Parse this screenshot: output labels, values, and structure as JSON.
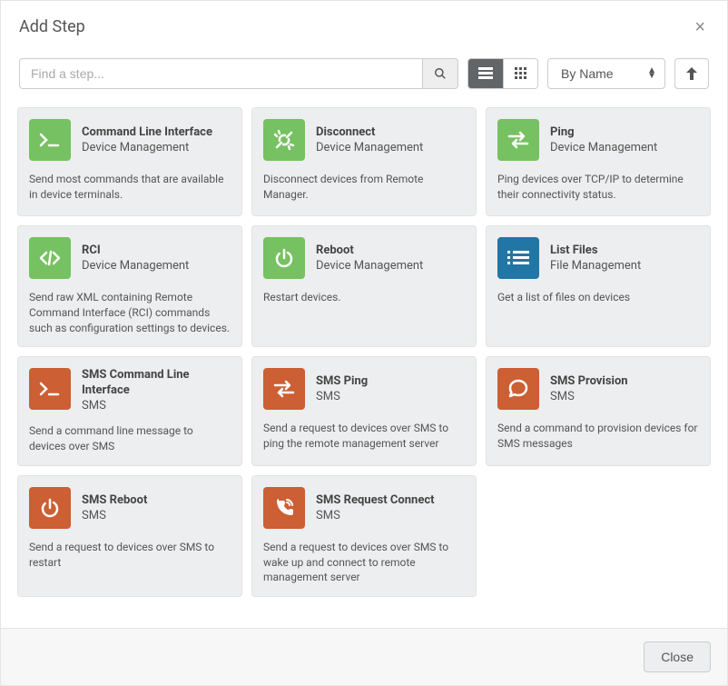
{
  "header": {
    "title": "Add Step"
  },
  "toolbar": {
    "search_placeholder": "Find a step...",
    "sort_selected": "By Name"
  },
  "cards": [
    {
      "title": "Command Line Interface",
      "category": "Device Management",
      "description": "Send most commands that are available in device terminals.",
      "icon": "terminal",
      "color": "green"
    },
    {
      "title": "Disconnect",
      "category": "Device Management",
      "description": "Disconnect devices from Remote Manager.",
      "icon": "disconnect",
      "color": "green"
    },
    {
      "title": "Ping",
      "category": "Device Management",
      "description": "Ping devices over TCP/IP to determine their connectivity status.",
      "icon": "exchange",
      "color": "green"
    },
    {
      "title": "RCI",
      "category": "Device Management",
      "description": "Send raw XML containing Remote Command Interface (RCI) commands such as configuration settings to devices.",
      "icon": "code",
      "color": "green"
    },
    {
      "title": "Reboot",
      "category": "Device Management",
      "description": "Restart devices.",
      "icon": "power",
      "color": "green"
    },
    {
      "title": "List Files",
      "category": "File Management",
      "description": "Get a list of files on devices",
      "icon": "list",
      "color": "blue"
    },
    {
      "title": "SMS Command Line Interface",
      "category": "SMS",
      "description": "Send a command line message to devices over SMS",
      "icon": "terminal",
      "color": "orange"
    },
    {
      "title": "SMS Ping",
      "category": "SMS",
      "description": "Send a request to devices over SMS to ping the remote management server",
      "icon": "exchange",
      "color": "orange"
    },
    {
      "title": "SMS Provision",
      "category": "SMS",
      "description": "Send a command to provision devices for SMS messages",
      "icon": "chat",
      "color": "orange"
    },
    {
      "title": "SMS Reboot",
      "category": "SMS",
      "description": "Send a request to devices over SMS to restart",
      "icon": "power",
      "color": "orange"
    },
    {
      "title": "SMS Request Connect",
      "category": "SMS",
      "description": "Send a request to devices over SMS to wake up and connect to remote management server",
      "icon": "phone-ring",
      "color": "orange"
    }
  ],
  "footer": {
    "close_label": "Close"
  },
  "colors": {
    "green": "#76c161",
    "blue": "#2176a5",
    "orange": "#cc5f33"
  }
}
